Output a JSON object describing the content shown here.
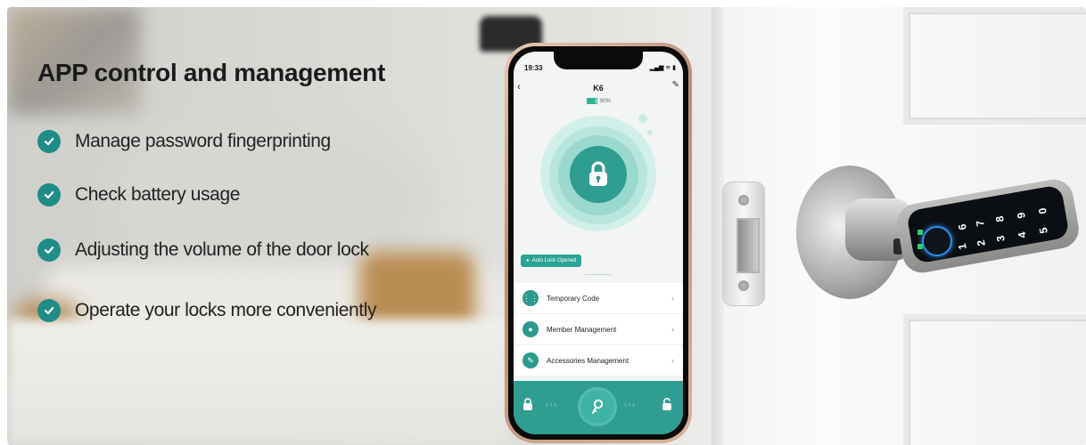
{
  "banner": {
    "title": "APP control and management",
    "features": [
      {
        "label": "Manage password fingerprinting"
      },
      {
        "label": "Check battery usage"
      },
      {
        "label": "Adjusting the volume of the door lock"
      },
      {
        "label": "Operate your locks more conveniently"
      }
    ],
    "colors": {
      "accent": "#1f8c86",
      "app_green": "#2f9e90"
    }
  },
  "phone": {
    "status_time": "19:33",
    "device_name": "K6",
    "battery_percent": "90%",
    "battery_level": 0.9,
    "auto_lock_label": "Auto Lock Opened",
    "menu": [
      {
        "label": "Temporary Code",
        "icon": "grid-icon"
      },
      {
        "label": "Member Management",
        "icon": "person-icon"
      },
      {
        "label": "Accessories Management",
        "icon": "brush-icon"
      }
    ]
  },
  "keypad": {
    "digits": [
      "0",
      "9",
      "8",
      "7",
      "6",
      "5",
      "4",
      "3",
      "2",
      "1"
    ]
  }
}
